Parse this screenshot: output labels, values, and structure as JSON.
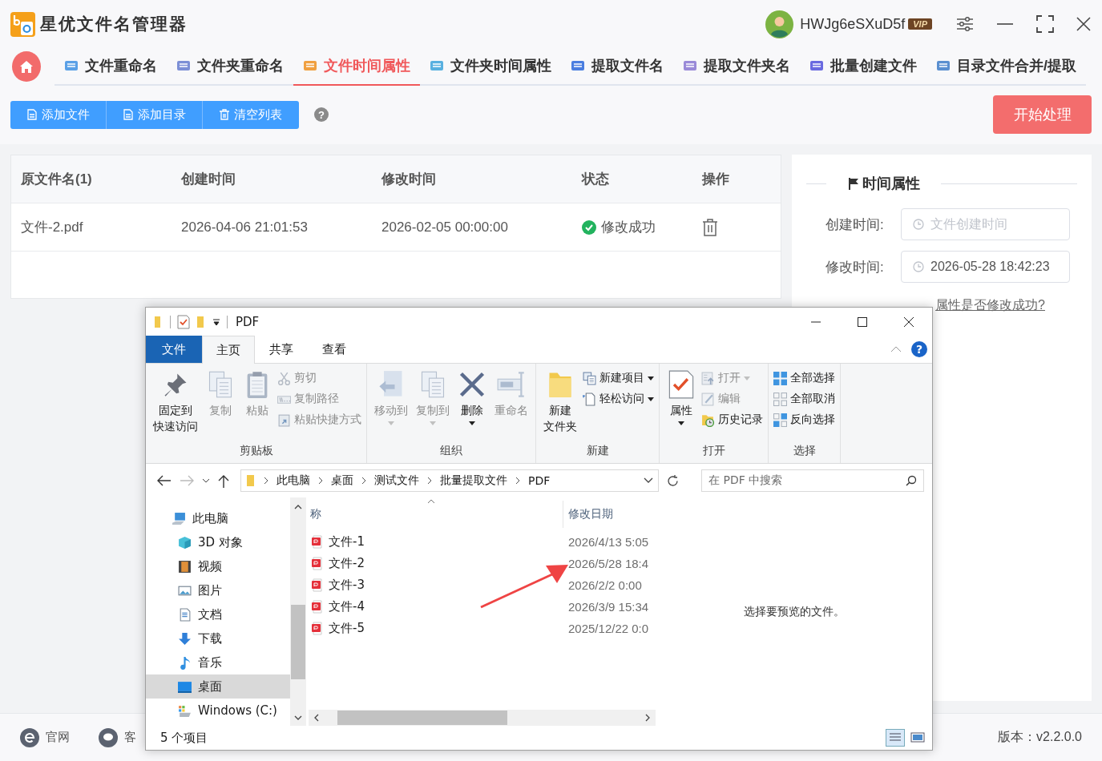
{
  "app": {
    "title": "星优文件名管理器",
    "user": "HWJg6eSXuD5f",
    "vip": "VIP"
  },
  "tabs": [
    {
      "label": "文件重命名",
      "selected": false
    },
    {
      "label": "文件夹重命名",
      "selected": false
    },
    {
      "label": "文件时间属性",
      "selected": true
    },
    {
      "label": "文件夹时间属性",
      "selected": false
    },
    {
      "label": "提取文件名",
      "selected": false
    },
    {
      "label": "提取文件夹名",
      "selected": false
    },
    {
      "label": "批量创建文件",
      "selected": false
    },
    {
      "label": "目录文件合并/提取",
      "selected": false
    }
  ],
  "toolbar": {
    "buttons": [
      "添加文件",
      "添加目录",
      "清空列表"
    ],
    "help": "?",
    "start": "开始处理"
  },
  "table": {
    "columns": [
      "原文件名(1)",
      "创建时间",
      "修改时间",
      "状态",
      "操作"
    ],
    "rows": [
      {
        "name": "文件-2.pdf",
        "created": "2026-04-06 21:01:53",
        "modified": "2026-02-05 00:00:00",
        "status": "修改成功",
        "success": true
      }
    ]
  },
  "time_panel": {
    "title": "时间属性",
    "fields": [
      {
        "label": "创建时间:",
        "placeholder": "文件创建时间"
      },
      {
        "label": "修改时间:",
        "value": "2026-05-28 18:42:23"
      }
    ],
    "link": "属性是否修改成功?"
  },
  "footer": {
    "links": [
      "官网",
      "客"
    ],
    "version": "版本：v2.2.0.0"
  },
  "explorer": {
    "title": "PDF",
    "ribbon_tabs": [
      {
        "label": "文件",
        "kind": "file",
        "selected": false
      },
      {
        "label": "主页",
        "kind": "tab",
        "selected": true
      },
      {
        "label": "共享",
        "kind": "tab",
        "selected": false
      },
      {
        "label": "查看",
        "kind": "tab",
        "selected": false
      }
    ],
    "help": "?",
    "groups": [
      {
        "label": "剪贴板",
        "items": [
          {
            "label": [
              "固定到",
              "快速访问"
            ],
            "kind": "large",
            "disabled": false,
            "dropdown": false
          },
          {
            "label": "复制",
            "kind": "large",
            "disabled": true,
            "dropdown": false
          },
          {
            "label": "粘贴",
            "kind": "large",
            "disabled": true,
            "dropdown": false
          },
          {
            "label": "剪切",
            "kind": "small",
            "disabled": true,
            "dropdown": false
          },
          {
            "label": "复制路径",
            "kind": "small",
            "disabled": true,
            "dropdown": false
          },
          {
            "label": "粘贴快捷方式",
            "kind": "small",
            "disabled": true,
            "dropdown": false
          }
        ]
      },
      {
        "label": "组织",
        "items": [
          {
            "label": "移动到",
            "kind": "large",
            "disabled": true,
            "dropdown": true
          },
          {
            "label": "复制到",
            "kind": "large",
            "disabled": true,
            "dropdown": true
          },
          {
            "label": "删除",
            "kind": "large",
            "disabled": false,
            "dropdown": true
          },
          {
            "label": "重命名",
            "kind": "large",
            "disabled": true,
            "dropdown": false
          }
        ]
      },
      {
        "label": "新建",
        "items": [
          {
            "label": [
              "新建",
              "文件夹"
            ],
            "kind": "large",
            "disabled": false,
            "dropdown": false
          },
          {
            "label": "新建项目",
            "kind": "small",
            "disabled": false,
            "dropdown": true
          },
          {
            "label": "轻松访问",
            "kind": "small",
            "disabled": false,
            "dropdown": true
          }
        ]
      },
      {
        "label": "打开",
        "items": [
          {
            "label": "属性",
            "kind": "large",
            "disabled": false,
            "dropdown": true
          },
          {
            "label": "打开",
            "kind": "small",
            "disabled": true,
            "dropdown": true
          },
          {
            "label": "编辑",
            "kind": "small",
            "disabled": true,
            "dropdown": false
          },
          {
            "label": "历史记录",
            "kind": "small",
            "disabled": false,
            "dropdown": false
          }
        ]
      },
      {
        "label": "选择",
        "items": [
          {
            "label": "全部选择",
            "kind": "small",
            "disabled": false,
            "dropdown": false
          },
          {
            "label": "全部取消",
            "kind": "small",
            "disabled": false,
            "dropdown": false
          },
          {
            "label": "反向选择",
            "kind": "small",
            "disabled": false,
            "dropdown": false
          }
        ]
      }
    ],
    "path": [
      "此电脑",
      "桌面",
      "测试文件",
      "批量提取文件",
      "PDF"
    ],
    "search_placeholder": "在 PDF 中搜索",
    "nav": [
      {
        "label": "此电脑",
        "selected": false,
        "children": [
          {
            "label": "3D 对象",
            "selected": false
          },
          {
            "label": "视频",
            "selected": false
          },
          {
            "label": "图片",
            "selected": false
          },
          {
            "label": "文档",
            "selected": false
          },
          {
            "label": "下载",
            "selected": false
          },
          {
            "label": "音乐",
            "selected": false
          },
          {
            "label": "桌面",
            "selected": true
          },
          {
            "label": "Windows (C:)",
            "selected": false
          }
        ]
      }
    ],
    "columns": [
      "称",
      "修改日期"
    ],
    "files": [
      {
        "name": "文件-1",
        "modified": "2026/4/13 5:05"
      },
      {
        "name": "文件-2",
        "modified": "2026/5/28 18:4"
      },
      {
        "name": "文件-3",
        "modified": "2026/2/2 0:00"
      },
      {
        "name": "文件-4",
        "modified": "2026/3/9 15:34"
      },
      {
        "name": "文件-5",
        "modified": "2025/12/22 0:0"
      }
    ],
    "preview_text": "选择要预览的文件。",
    "status": "5 个项目"
  }
}
